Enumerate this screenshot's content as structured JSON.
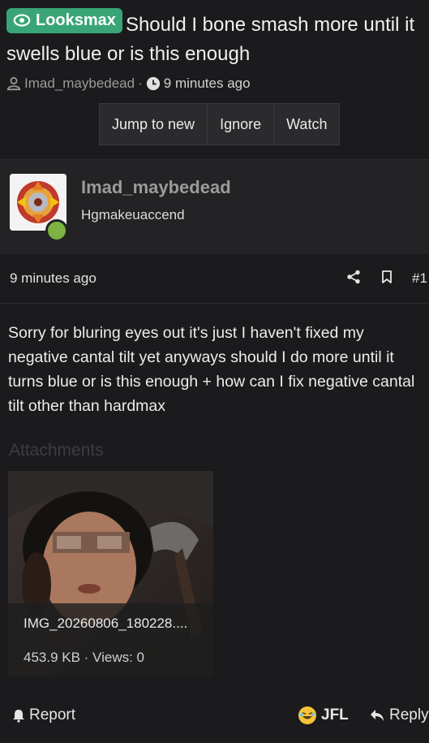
{
  "thread": {
    "prefix": "Looksmax",
    "title": "Should I bone smash more until it swells blue or is this enough",
    "author": "Imad_maybedead",
    "separator": "·",
    "time": "9 minutes ago"
  },
  "actions": {
    "jump": "Jump to new",
    "ignore": "Ignore",
    "watch": "Watch"
  },
  "post": {
    "username": "Imad_maybedead",
    "user_title": "Hgmakeuaccend",
    "date": "9 minutes ago",
    "number": "#1",
    "body": "Sorry for bluring eyes out it's just I haven't fixed my negative cantal tilt yet anyways should I do more until it turns blue or is this enough + how can I fix negative cantal tilt other than hardmax",
    "attachments_label": "Attachments",
    "attachment": {
      "filename": "IMG_20260806_180228....",
      "meta": "453.9 KB · Views: 0"
    }
  },
  "footer": {
    "report": "Report",
    "reaction": "JFL",
    "reply": "Reply"
  },
  "colors": {
    "prefix_bg": "#39a577",
    "background": "#1b1b1d",
    "online": "#7cb342"
  }
}
